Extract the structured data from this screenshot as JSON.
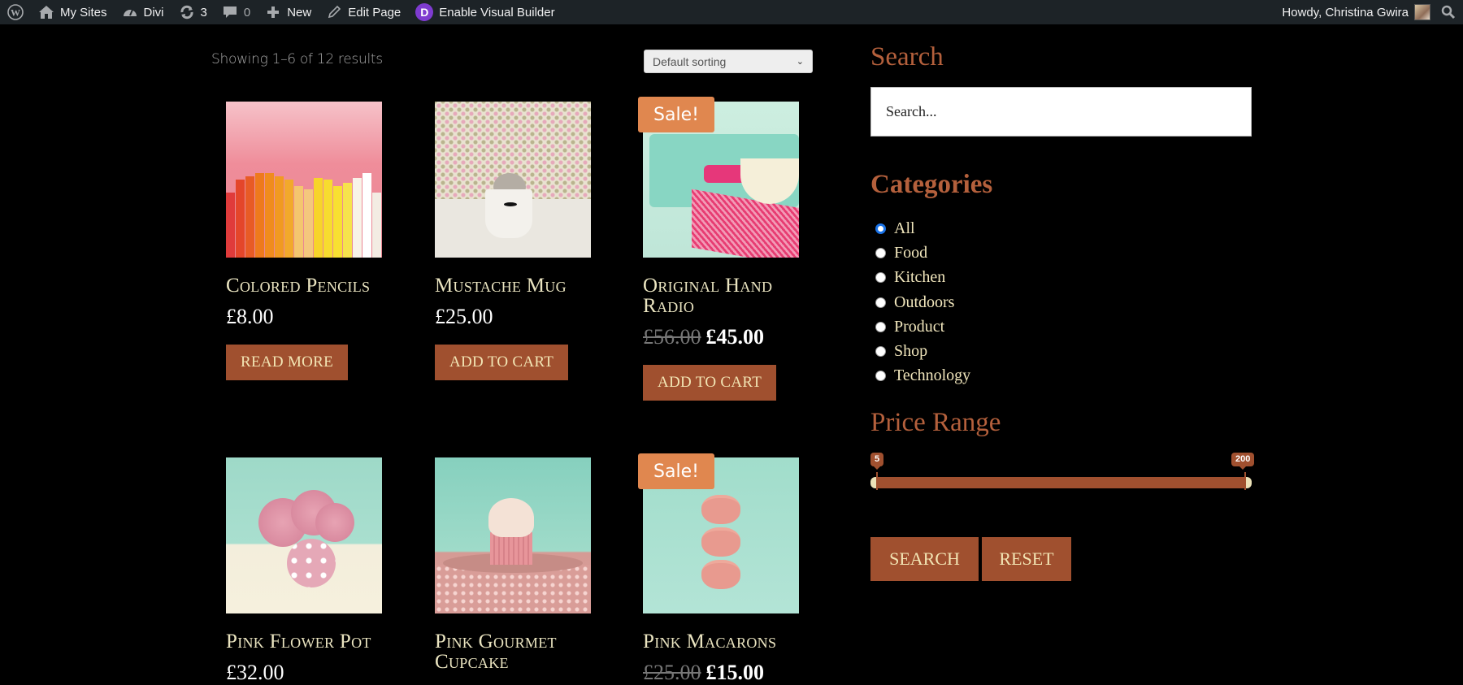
{
  "adminbar": {
    "wp_logo": "wordpress-icon",
    "my_sites": "My Sites",
    "site_name": "Divi",
    "updates_count": "3",
    "comments_count": "0",
    "new_label": "New",
    "edit_page": "Edit Page",
    "visual_builder": "Enable Visual Builder",
    "divi_letter": "D",
    "greeting": "Howdy, Christina Gwira"
  },
  "shop": {
    "result_count": "Showing 1–6 of 12 results",
    "sorting_selected": "Default sorting",
    "sale_badge": "Sale!",
    "products": [
      {
        "title": "Colored Pencils",
        "price": "£8.00",
        "button": "READ MORE"
      },
      {
        "title": "Mustache Mug",
        "price": "£25.00",
        "button": "ADD TO CART"
      },
      {
        "title": "Original Hand Radio",
        "old_price": "£56.00",
        "price": "£45.00",
        "button": "ADD TO CART",
        "sale": true
      },
      {
        "title": "Pink Flower Pot",
        "price": "£32.00"
      },
      {
        "title": "Pink Gourmet Cupcake"
      },
      {
        "title": "Pink Macarons",
        "old_price": "£25.00",
        "price": "£15.00",
        "sale": true
      }
    ]
  },
  "sidebar": {
    "search_title": "Search",
    "search_placeholder": "Search...",
    "categories_title": "Categories",
    "categories": [
      "All",
      "Food",
      "Kitchen",
      "Outdoors",
      "Product",
      "Shop",
      "Technology"
    ],
    "categories_selected": "All",
    "price_range_title": "Price Range",
    "price_min": "5",
    "price_max": "200",
    "search_button": "SEARCH",
    "reset_button": "RESET"
  },
  "colors": {
    "accent": "#a0502f",
    "heading": "#b4603c",
    "sale_badge": "#e0874f",
    "title_text": "#eae4c0",
    "adminbar_bg": "#1d2327"
  }
}
